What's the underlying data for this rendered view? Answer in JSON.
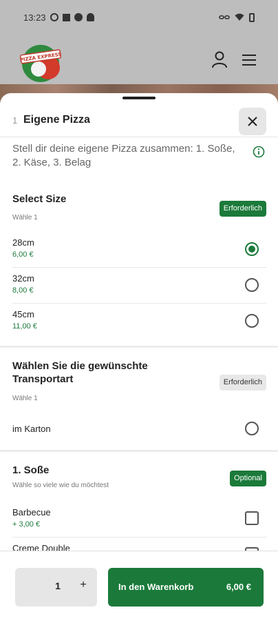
{
  "status_bar": {
    "time": "13:23"
  },
  "app": {
    "logo_text": "PIZZA EXPRESS"
  },
  "sheet": {
    "quantity_badge": "1",
    "title": "Eigene Pizza",
    "description": "Stell dir deine eigene Pizza zusammen: 1. Soße, 2. Käse, 3. Belag"
  },
  "groups": [
    {
      "title": "Select Size",
      "subtitle": "Wähle 1",
      "tag": "Erforderlich",
      "options": [
        {
          "name": "28cm",
          "price": "6,00 €",
          "selected": true
        },
        {
          "name": "32cm",
          "price": "8,00 €",
          "selected": false
        },
        {
          "name": "45cm",
          "price": "11,00 €",
          "selected": false
        }
      ]
    },
    {
      "title": "Wählen Sie die gewünschte Transportart",
      "subtitle": "Wähle 1",
      "tag": "Erforderlich",
      "options": [
        {
          "name": "im Karton",
          "price": "",
          "selected": false
        }
      ]
    },
    {
      "title": "1. Soße",
      "subtitle": "Wähle so viele wie du möchtest",
      "tag": "Optional",
      "options": [
        {
          "name": "Barbecue",
          "price": "+ 3,00 €",
          "selected": false
        },
        {
          "name": "Creme Double",
          "price": "",
          "selected": false
        }
      ]
    }
  ],
  "bottom_bar": {
    "quantity": "1",
    "plus": "+",
    "cart_label": "In den Warenkorb",
    "cart_price": "6,00 €"
  },
  "colors": {
    "accent": "#1b7a3a",
    "tag_grey": "#e8e8e8"
  },
  "icons": [
    "user-icon",
    "hamburger-menu-icon",
    "close-icon",
    "info-icon"
  ]
}
